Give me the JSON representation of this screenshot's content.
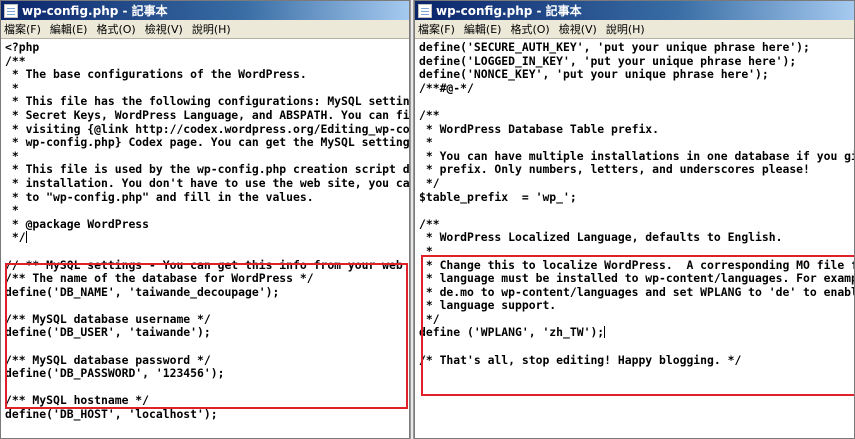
{
  "windows": [
    {
      "title": "wp-config.php - 記事本",
      "menu": [
        "檔案(F)",
        "編輯(E)",
        "格式(O)",
        "檢視(V)",
        "說明(H)"
      ],
      "lines": [
        "<?php",
        "/**",
        " * The base configurations of the WordPress.",
        " *",
        " * This file has the following configurations: MySQL settings, Table Prefix,",
        " * Secret Keys, WordPress Language, and ABSPATH. You can find more information by",
        " * visiting {@link http://codex.wordpress.org/Editing_wp-config.php Editing",
        " * wp-config.php} Codex page. You can get the MySQL settings from your web host.",
        " *",
        " * This file is used by the wp-config.php creation script during the",
        " * installation. You don't have to use the web site, you can just copy this file",
        " * to \"wp-config.php\" and fill in the values.",
        " *",
        " * @package WordPress",
        " */",
        "",
        "// ** MySQL settings - You can get this info from your web host ** //",
        "/** The name of the database for WordPress */",
        "define('DB_NAME', 'taiwande_decoupage');",
        "",
        "/** MySQL database username */",
        "define('DB_USER', 'taiwande');",
        "",
        "/** MySQL database password */",
        "define('DB_PASSWORD', '123456');",
        "",
        "/** MySQL hostname */",
        "define('DB_HOST', 'localhost');"
      ]
    },
    {
      "title": "wp-config.php - 記事本",
      "menu": [
        "檔案(F)",
        "編輯(E)",
        "格式(O)",
        "檢視(V)",
        "說明(H)"
      ],
      "lines": [
        "define('SECURE_AUTH_KEY', 'put your unique phrase here');",
        "define('LOGGED_IN_KEY', 'put your unique phrase here');",
        "define('NONCE_KEY', 'put your unique phrase here');",
        "/**#@-*/",
        "",
        "/**",
        " * WordPress Database Table prefix.",
        " *",
        " * You can have multiple installations in one database if you give each a unique",
        " * prefix. Only numbers, letters, and underscores please!",
        " */",
        "$table_prefix  = 'wp_';",
        "",
        "/**",
        " * WordPress Localized Language, defaults to English.",
        " *",
        " * Change this to localize WordPress.  A corresponding MO file for the chosen",
        " * language must be installed to wp-content/languages. For example, install",
        " * de.mo to wp-content/languages and set WPLANG to 'de' to enable German",
        " * language support.",
        " */",
        "define ('WPLANG', 'zh_TW');",
        "",
        "/* That's all, stop editing! Happy blogging. */"
      ]
    }
  ],
  "highlight_color": "#e0202a"
}
